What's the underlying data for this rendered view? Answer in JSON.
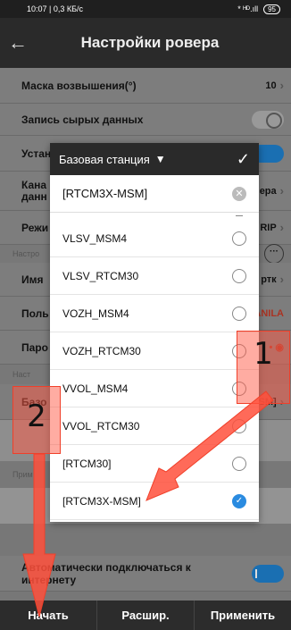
{
  "status_bar": {
    "time_speed": "10:07 | 0,3 КБ/с",
    "signal": "* ᴴᴰ.ıll",
    "battery": "95"
  },
  "app_bar": {
    "title": "Настройки ровера"
  },
  "settings": {
    "elevation_mask_label": "Маска возвышения(°)",
    "elevation_mask_value": "10",
    "raw_data_label": "Запись сырых данных",
    "install_label": "Устан",
    "channel_label": "Кана данн",
    "channel_value": "ера",
    "mode_label": "Режи",
    "mode_value": "RIP",
    "section_settings": "Настро",
    "name_label": "Имя",
    "name_value": "ртк",
    "user_label": "Поль",
    "user_value": "ANILA",
    "password_label": "Паро",
    "section_2": "Наст",
    "base_label": "Базо",
    "base_value": "SM]",
    "section_3": "Прим",
    "auto_connect_label": "Автоматически подключаться к интернету"
  },
  "bottom_bar": {
    "start": "Начать",
    "extended": "Расшир.",
    "apply": "Применить"
  },
  "dialog": {
    "title": "Базовая станция",
    "search_value": "[RTCM3X-MSM]",
    "options": [
      {
        "label": "VLSV_MSM4",
        "selected": false
      },
      {
        "label": "VLSV_RTCM30",
        "selected": false
      },
      {
        "label": "VOZH_MSM4",
        "selected": false
      },
      {
        "label": "VOZH_RTCM30",
        "selected": false
      },
      {
        "label": "VVOL_MSM4",
        "selected": false
      },
      {
        "label": "VVOL_RTCM30",
        "selected": false
      },
      {
        "label": "[RTCM30]",
        "selected": false
      },
      {
        "label": "[RTCM3X-MSM]",
        "selected": true
      }
    ]
  },
  "annotations": {
    "marker_1": "1",
    "marker_2": "2"
  },
  "colors": {
    "accent": "#2a8be0",
    "highlight": "#f0402a"
  }
}
